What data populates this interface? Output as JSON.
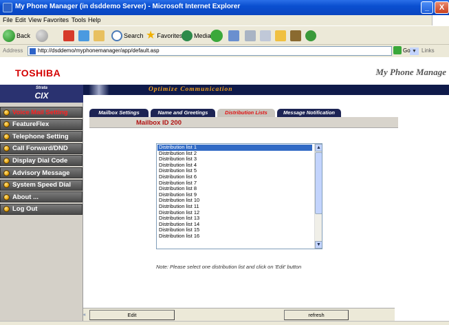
{
  "window": {
    "title": "My Phone Manager (in dsddemo Server) - Microsoft Internet Explorer",
    "minimize": "_",
    "close": "X"
  },
  "menu": [
    "File",
    "Edit",
    "View",
    "Favorites",
    "Tools",
    "Help"
  ],
  "toolbar": {
    "back": "Back",
    "search": "Search",
    "favorites": "Favorites",
    "media": "Media"
  },
  "address": {
    "label": "Address",
    "url": "http://dsddemo/myphonemanager/app/default.asp",
    "go": "Go",
    "links": "Links"
  },
  "logo": {
    "brand": "TOSHIBA",
    "strata_top": "Strata",
    "strata_bottom": "CIX"
  },
  "header": {
    "app_title": "My Phone Manage",
    "tagline": "Optimize Communication"
  },
  "nav": [
    {
      "label": "Voice Mail Setting",
      "active": true
    },
    {
      "label": "FeatureFlex",
      "active": false
    },
    {
      "label": "Telephone Setting",
      "active": false
    },
    {
      "label": "Call Forward/DND",
      "active": false
    },
    {
      "label": "Display Dial Code",
      "active": false
    },
    {
      "label": "Advisory Message",
      "active": false
    },
    {
      "label": "System Speed Dial",
      "active": false
    },
    {
      "label": "About ...",
      "active": false
    },
    {
      "label": "Log Out",
      "active": false
    }
  ],
  "tabs": [
    {
      "label": "Mailbox Settings",
      "active": false
    },
    {
      "label": "Name and Greetings",
      "active": false
    },
    {
      "label": "Distribution Lists",
      "active": true
    },
    {
      "label": "Message Notification",
      "active": false
    }
  ],
  "mailbox": {
    "label": "Mailbox ID 200"
  },
  "list": {
    "items": [
      "Distribution list 1",
      "Distribution list 2",
      "Distribution list 3",
      "Distribution list 4",
      "Distribution list 5",
      "Distribution list 6",
      "Distribution list 7",
      "Distribution list 8",
      "Distribution list 9",
      "Distribution list 10",
      "Distribution list 11",
      "Distribution list 12",
      "Distribution list 13",
      "Distribution list 14",
      "Distribution list 15",
      "Distribution list 16"
    ],
    "selected_index": 0
  },
  "note": "Note: Please select one distribution list and click on 'Edit' button",
  "buttons": {
    "edit": "Edit",
    "refresh": "refresh",
    "collapse": "«"
  },
  "colors": {
    "accent": "#0f1a4a",
    "nav_active_text": "#ff2020",
    "brand_red": "#d40000",
    "tagline": "#f0a020"
  }
}
